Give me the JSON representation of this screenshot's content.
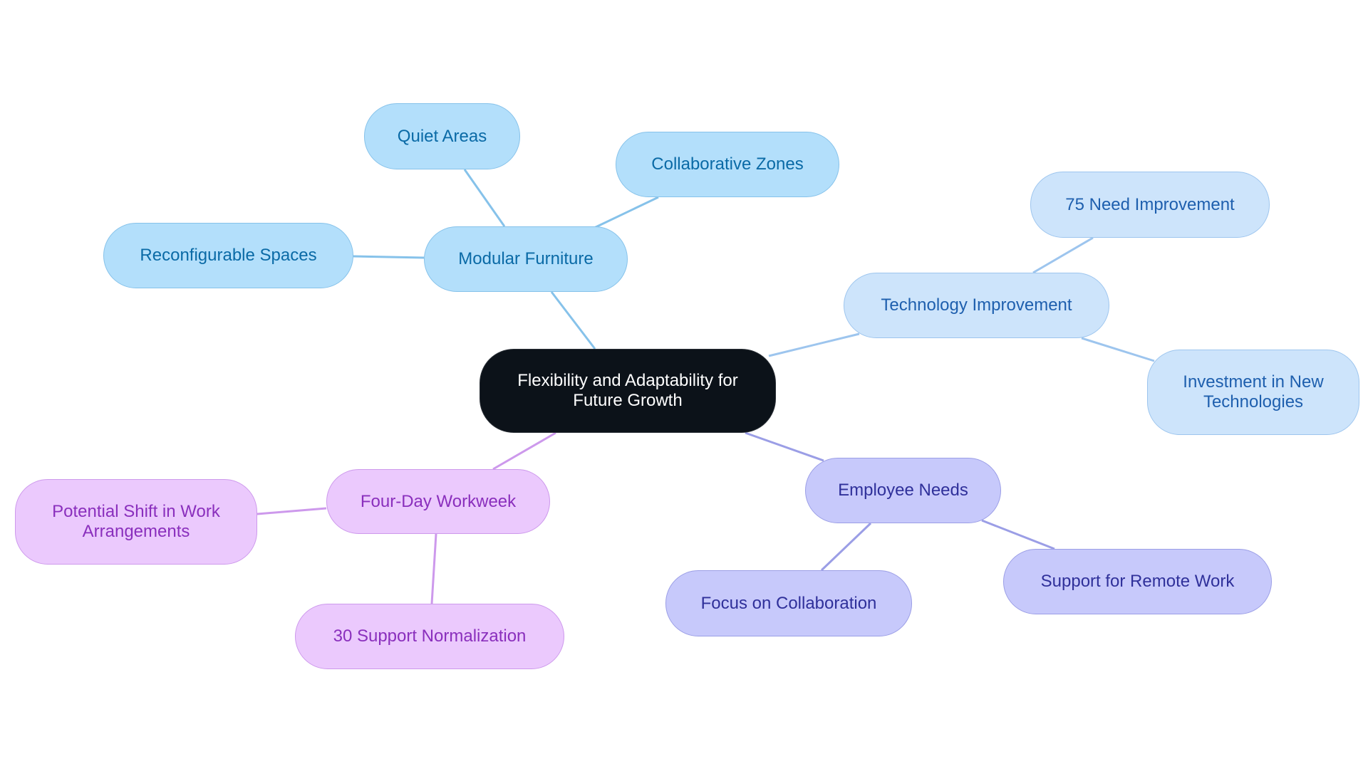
{
  "diagram": {
    "type": "mind-map",
    "root": {
      "id": "root",
      "label": "Flexibility and Adaptability for Future Growth"
    },
    "branches": [
      {
        "id": "modular",
        "label": "Modular Furniture",
        "theme": "sky",
        "children": [
          {
            "id": "quiet",
            "label": "Quiet Areas"
          },
          {
            "id": "collab-zones",
            "label": "Collaborative Zones"
          },
          {
            "id": "reconfig",
            "label": "Reconfigurable Spaces"
          }
        ]
      },
      {
        "id": "tech",
        "label": "Technology Improvement",
        "theme": "blue",
        "children": [
          {
            "id": "need-improve",
            "label": "75 Need Improvement"
          },
          {
            "id": "investment",
            "label": "Investment in New Technologies"
          }
        ]
      },
      {
        "id": "employee",
        "label": "Employee Needs",
        "theme": "indigo",
        "children": [
          {
            "id": "focus-collab",
            "label": "Focus on Collaboration"
          },
          {
            "id": "remote",
            "label": "Support for Remote Work"
          }
        ]
      },
      {
        "id": "fourday",
        "label": "Four-Day Workweek",
        "theme": "purple",
        "children": [
          {
            "id": "shift",
            "label": "Potential Shift in Work Arrangements"
          },
          {
            "id": "normalization",
            "label": "30 Support Normalization"
          }
        ]
      }
    ],
    "colors": {
      "root_fill": "#0c1219",
      "sky_edge": "#86c2ea",
      "blue_edge": "#9dc5ee",
      "indigo_edge": "#9b9ee6",
      "purple_edge": "#cd99ec"
    }
  }
}
